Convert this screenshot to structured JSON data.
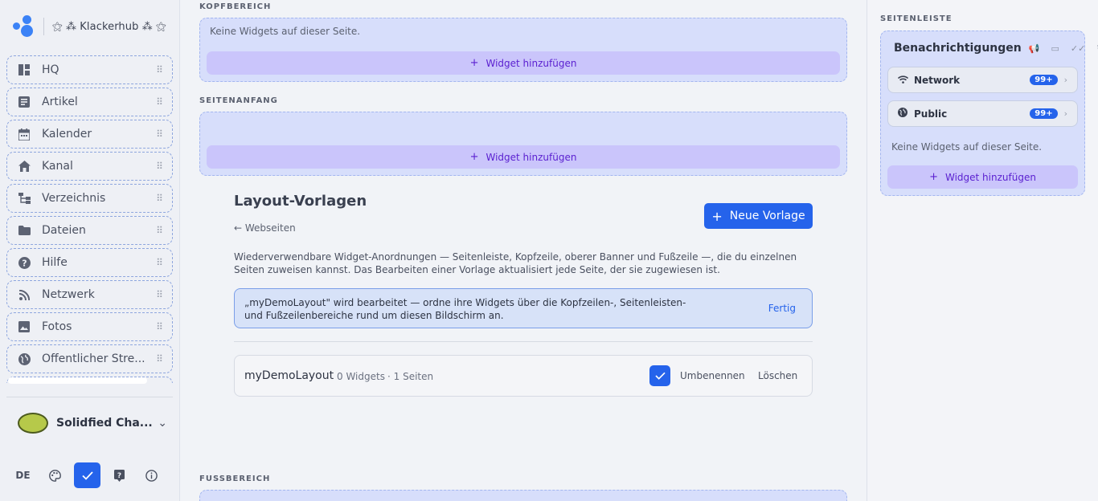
{
  "app": {
    "name": "⚝ ⁂ Klackerhub ⁂ ⚝"
  },
  "nav": {
    "items": [
      {
        "label": "HQ",
        "icon": "dashboard-icon"
      },
      {
        "label": "Artikel",
        "icon": "article-icon"
      },
      {
        "label": "Kalender",
        "icon": "calendar-icon"
      },
      {
        "label": "Kanal",
        "icon": "home-icon"
      },
      {
        "label": "Verzeichnis",
        "icon": "tree-icon"
      },
      {
        "label": "Dateien",
        "icon": "folder-icon"
      },
      {
        "label": "Hilfe",
        "icon": "help-icon"
      },
      {
        "label": "Netzwerk",
        "icon": "rss-icon"
      },
      {
        "label": "Fotos",
        "icon": "photo-icon"
      },
      {
        "label": "Öffentlicher Stre...",
        "icon": "globe-icon"
      }
    ]
  },
  "user": {
    "name": "Solidfied Cha..."
  },
  "footer": {
    "language": "DE"
  },
  "sections": {
    "header_title": "KOPFBEREICH",
    "top_title": "SEITENANFANG",
    "footer_title": "FUSSBEREICH",
    "sidebar_title": "SEITENLEISTE",
    "no_widgets": "Keine Widgets auf dieser Seite.",
    "add_widget": "Widget hinzufügen"
  },
  "templates": {
    "title": "Layout-Vorlagen",
    "back_label": "Webseiten",
    "new_button": "Neue Vorlage",
    "description": "Wiederverwendbare Widget-Anordnungen — Seitenleiste, Kopfzeile, oberer Banner und Fußzeile —, die du einzelnen Seiten zuweisen kannst. Das Bearbeiten einer Vorlage aktualisiert jede Seite, der sie zugewiesen ist.",
    "editing_notice": "„myDemoLayout\" wird bearbeitet — ordne ihre Widgets über die Kopfzeilen-, Seitenleisten- und Fußzeilenbereiche rund um diesen Bildschirm an.",
    "done_label": "Fertig",
    "rows": [
      {
        "name": "myDemoLayout",
        "widgets": "0 Widgets",
        "pages": "· 1 Seiten",
        "rename": "Umbenennen",
        "delete": "Löschen"
      }
    ]
  },
  "notifications": {
    "title": "Benachrichtigungen",
    "channels": [
      {
        "name": "Network",
        "count": "99+",
        "icon": "wifi-icon"
      },
      {
        "name": "Public",
        "count": "99+",
        "icon": "globe-icon"
      }
    ]
  },
  "colors": {
    "accent": "#2563eb",
    "zone": "#d7defb",
    "add_button": "#cac5fb",
    "add_text": "#5a1fd0",
    "online": "#22c55e"
  }
}
